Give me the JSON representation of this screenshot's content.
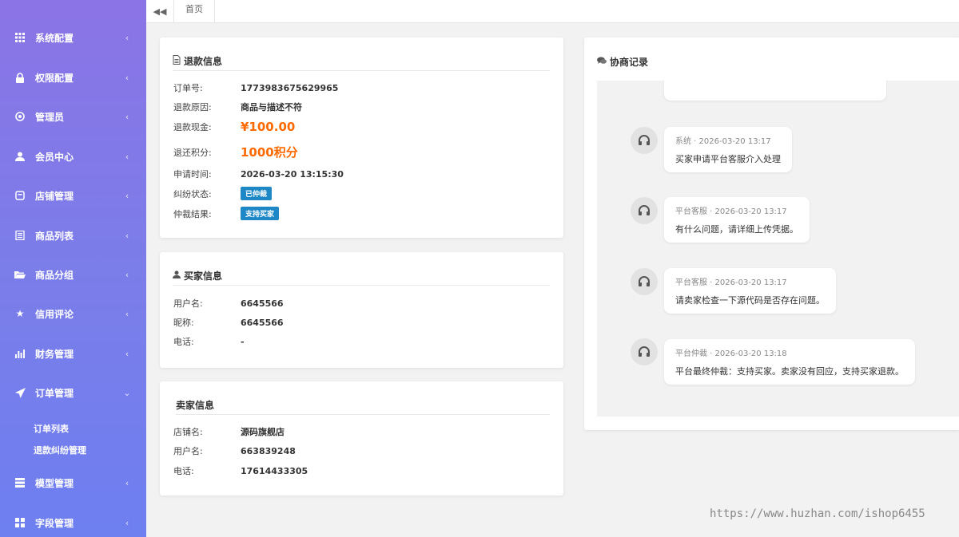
{
  "sidebar": {
    "items": [
      {
        "label": "系统配置",
        "icon": "grid-icon",
        "expanded": false
      },
      {
        "label": "权限配置",
        "icon": "lock-icon",
        "expanded": false
      },
      {
        "label": "管理员",
        "icon": "circle-dot-icon",
        "expanded": false
      },
      {
        "label": "会员中心",
        "icon": "user-icon",
        "expanded": false
      },
      {
        "label": "店铺管理",
        "icon": "store-icon",
        "expanded": false
      },
      {
        "label": "商品列表",
        "icon": "list-icon",
        "expanded": false
      },
      {
        "label": "商品分组",
        "icon": "folder-open-icon",
        "expanded": false
      },
      {
        "label": "信用评论",
        "icon": "star-icon",
        "expanded": false
      },
      {
        "label": "财务管理",
        "icon": "bar-chart-icon",
        "expanded": false
      },
      {
        "label": "订单管理",
        "icon": "send-icon",
        "expanded": true
      },
      {
        "label": "模型管理",
        "icon": "model-icon",
        "expanded": false
      },
      {
        "label": "字段管理",
        "icon": "fields-icon",
        "expanded": false
      }
    ],
    "order_sub_items": [
      "订单列表",
      "退款纠纷管理"
    ]
  },
  "topbar": {
    "home_tab": "首页"
  },
  "refund": {
    "title": "退款信息",
    "rows": [
      {
        "key": "订单号:",
        "value": "1773983675629965"
      },
      {
        "key": "退款原因:",
        "value": "商品与描述不符"
      },
      {
        "key": "退款现金:",
        "value": "¥100.00"
      },
      {
        "key": "退还积分:",
        "value": "1000积分"
      },
      {
        "key": "申请时间:",
        "value": "2026-03-20 13:15:30"
      },
      {
        "key": "纠纷状态:",
        "value": "已仲裁"
      },
      {
        "key": "仲裁结果:",
        "value": "支持买家"
      }
    ]
  },
  "buyer": {
    "title": "买家信息",
    "rows": [
      {
        "key": "用户名:",
        "value": "6645566"
      },
      {
        "key": "昵称:",
        "value": "6645566"
      },
      {
        "key": "电话:",
        "value": "-"
      }
    ]
  },
  "seller": {
    "title": "卖家信息",
    "rows": [
      {
        "key": "店铺名:",
        "value": "源码旗舰店"
      },
      {
        "key": "用户名:",
        "value": "663839248"
      },
      {
        "key": "电话:",
        "value": "17614433305"
      }
    ]
  },
  "negotiation": {
    "title": "协商记录",
    "messages": [
      {
        "meta": "系统 · 2026-03-20 13:17",
        "text": "买家申请平台客服介入处理"
      },
      {
        "meta": "平台客服 · 2026-03-20 13:17",
        "text": "有什么问题，请详细上传凭据。"
      },
      {
        "meta": "平台客服 · 2026-03-20 13:17",
        "text": "请卖家检查一下源代码是否存在问题。"
      },
      {
        "meta": "平台仲裁 · 2026-03-20 13:18",
        "text": "平台最终仲裁：支持买家。卖家没有回应，支持买家退款。"
      }
    ]
  },
  "watermark": "https://www.huzhan.com/ishop6455",
  "colors": {
    "sidebar_top": "#8b74e6",
    "sidebar_bottom": "#6e7ff0",
    "money": "#ff6a00",
    "badge": "#1e88c7"
  }
}
